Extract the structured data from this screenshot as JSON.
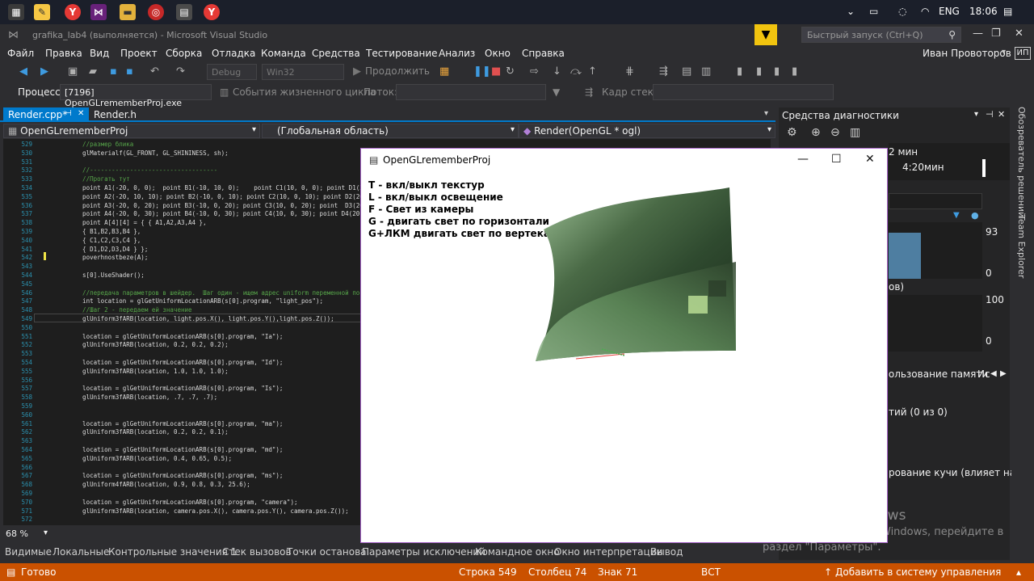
{
  "taskbar": {
    "lang": "ENG",
    "time": "18:06"
  },
  "window": {
    "title": "grafika_lab4 (выполняется) - Microsoft Visual Studio",
    "quick_launch_placeholder": "Быстрый запуск (Ctrl+Q)"
  },
  "menu": [
    "Файл",
    "Правка",
    "Вид",
    "Проект",
    "Сборка",
    "Отладка",
    "Команда",
    "Средства",
    "Тестирование",
    "Анализ",
    "Окно",
    "Справка"
  ],
  "user": {
    "name": "Иван Провоторов",
    "initials": "ИП"
  },
  "toolbar": {
    "config": "Debug",
    "platform": "Win32",
    "continue_label": "Продолжить",
    "process_label": "Процесс:",
    "process_value": "[7196] OpenGLrememberProj.exe",
    "lifecycle_label": "События жизненного цикла",
    "thread_label": "Поток:",
    "stack_label": "Кадр стека:"
  },
  "tabs": {
    "active": "Render.cpp*",
    "other": "Render.h"
  },
  "nav": {
    "project": "OpenGLrememberProj",
    "scope": "(Глобальная область)",
    "member": "Render(OpenGL * ogl)"
  },
  "code_lines": [
    {
      "n": "529",
      "t": "    //размер блика",
      "c": "cmt"
    },
    {
      "n": "530",
      "t": "    glMaterialf(GL_FRONT, GL_SHININESS, sh);",
      "c": ""
    },
    {
      "n": "531",
      "t": "",
      "c": ""
    },
    {
      "n": "532",
      "t": "    //-----------------------------------",
      "c": "cmt"
    },
    {
      "n": "533",
      "t": "    //Прогать тут",
      "c": "cmt"
    },
    {
      "n": "534",
      "t": "    point A1(-20, 0, 0);  point B1(-10, 10, 0);    point C1(10, 0, 0); point D1(20,",
      "c": ""
    },
    {
      "n": "535",
      "t": "    point A2(-20, 10, 10); point B2(-10, 0, 10); point C2(10, 0, 10); point D2(20, 0",
      "c": ""
    },
    {
      "n": "536",
      "t": "    point A3(-20, 0, 20); point B3(-10, 0, 20); point C3(10, 0, 20); point  D3(20, -",
      "c": ""
    },
    {
      "n": "537",
      "t": "    point A4(-20, 0, 30); point B4(-10, 0, 30); point C4(10, 0, 30); point D4(20, 0",
      "c": ""
    },
    {
      "n": "538",
      "t": "    point A[4][4] = { { A1,A2,A3,A4 },",
      "c": ""
    },
    {
      "n": "539",
      "t": "    { B1,B2,B3,B4 },",
      "c": ""
    },
    {
      "n": "540",
      "t": "    { C1,C2,C3,C4 },",
      "c": ""
    },
    {
      "n": "541",
      "t": "    { D1,D2,D3,D4 } };",
      "c": ""
    },
    {
      "n": "542",
      "t": "    poverhnostbeze(A);",
      "c": ""
    },
    {
      "n": "543",
      "t": "",
      "c": ""
    },
    {
      "n": "544",
      "t": "    s[0].UseShader();",
      "c": ""
    },
    {
      "n": "545",
      "t": "",
      "c": ""
    },
    {
      "n": "546",
      "t": "    //передача параметров в шейдер.  Шаг один - ищем адрес uniform переменной по ее",
      "c": "cmt"
    },
    {
      "n": "547",
      "t": "    int location = glGetUniformLocationARB(s[0].program, \"light_pos\");",
      "c": ""
    },
    {
      "n": "548",
      "t": "    //Шаг 2 - передаем ей значение",
      "c": "cmt"
    },
    {
      "n": "549",
      "t": "    glUniform3fARB(location, light.pos.X(), light.pos.Y(),light.pos.Z());",
      "c": ""
    },
    {
      "n": "550",
      "t": "",
      "c": ""
    },
    {
      "n": "551",
      "t": "    location = glGetUniformLocationARB(s[0].program, \"Ia\");",
      "c": ""
    },
    {
      "n": "552",
      "t": "    glUniform3fARB(location, 0.2, 0.2, 0.2);",
      "c": ""
    },
    {
      "n": "553",
      "t": "",
      "c": ""
    },
    {
      "n": "554",
      "t": "    location = glGetUniformLocationARB(s[0].program, \"Id\");",
      "c": ""
    },
    {
      "n": "555",
      "t": "    glUniform3fARB(location, 1.0, 1.0, 1.0);",
      "c": ""
    },
    {
      "n": "556",
      "t": "",
      "c": ""
    },
    {
      "n": "557",
      "t": "    location = glGetUniformLocationARB(s[0].program, \"Is\");",
      "c": ""
    },
    {
      "n": "558",
      "t": "    glUniform3fARB(location, .7, .7, .7);",
      "c": ""
    },
    {
      "n": "559",
      "t": "",
      "c": ""
    },
    {
      "n": "560",
      "t": "",
      "c": ""
    },
    {
      "n": "561",
      "t": "    location = glGetUniformLocationARB(s[0].program, \"ma\");",
      "c": ""
    },
    {
      "n": "562",
      "t": "    glUniform3fARB(location, 0.2, 0.2, 0.1);",
      "c": ""
    },
    {
      "n": "563",
      "t": "",
      "c": ""
    },
    {
      "n": "564",
      "t": "    location = glGetUniformLocationARB(s[0].program, \"md\");",
      "c": ""
    },
    {
      "n": "565",
      "t": "    glUniform3fARB(location, 0.4, 0.65, 0.5);",
      "c": ""
    },
    {
      "n": "566",
      "t": "",
      "c": ""
    },
    {
      "n": "567",
      "t": "    location = glGetUniformLocationARB(s[0].program, \"ms\");",
      "c": ""
    },
    {
      "n": "568",
      "t": "    glUniform4fARB(location, 0.9, 0.8, 0.3, 25.6);",
      "c": ""
    },
    {
      "n": "569",
      "t": "",
      "c": ""
    },
    {
      "n": "570",
      "t": "    location = glGetUniformLocationARB(s[0].program, \"camera\");",
      "c": ""
    },
    {
      "n": "571",
      "t": "    glUniform3fARB(location, camera.pos.X(), camera.pos.Y(), camera.pos.Z());",
      "c": ""
    },
    {
      "n": "572",
      "t": "",
      "c": ""
    }
  ],
  "zoom": "68 %",
  "bottom_tabs": [
    "Видимые",
    "Локальные",
    "Контрольные значения 1",
    "Стек вызовов",
    "Точки останова",
    "Параметры исключений",
    "Командное окно",
    "Окно интерпретации",
    "Вывод"
  ],
  "status": {
    "ready": "Готово",
    "line": "Строка 549",
    "col": "Столбец 74",
    "char": "Знак 71",
    "mode": "ВСТ",
    "vcs": "Добавить в систему управления версиями"
  },
  "diagnostics": {
    "title": "Средства диагностики",
    "time_suffix": "2 мин",
    "time_mark": "4:20мин",
    "cpu_max": "93",
    "cpu_min": "0",
    "proc_label": "ов)",
    "mem_max": "100",
    "mem_min": "0",
    "memory_tab": "пользование памяти",
    "cpu_tab": "Ис",
    "events": "тий (0 из 0)",
    "heap": "рование кучи (влияет на пр"
  },
  "side_panels": [
    "Обозреватель решений",
    "Team Explorer"
  ],
  "gl_window": {
    "title": "OpenGLrememberProj",
    "help": [
      "T - вкл/выкл текстур",
      "L - вкл/выкл освещение",
      "F - Свет из камеры",
      "G - двигать свет по горизонтали",
      "G+ЛКМ двигать свет по вертекали"
    ]
  },
  "activation": {
    "title": "Активация Windows",
    "line1": "Чтобы активировать Windows, перейдите в",
    "line2": "раздел \"Параметры\"."
  }
}
